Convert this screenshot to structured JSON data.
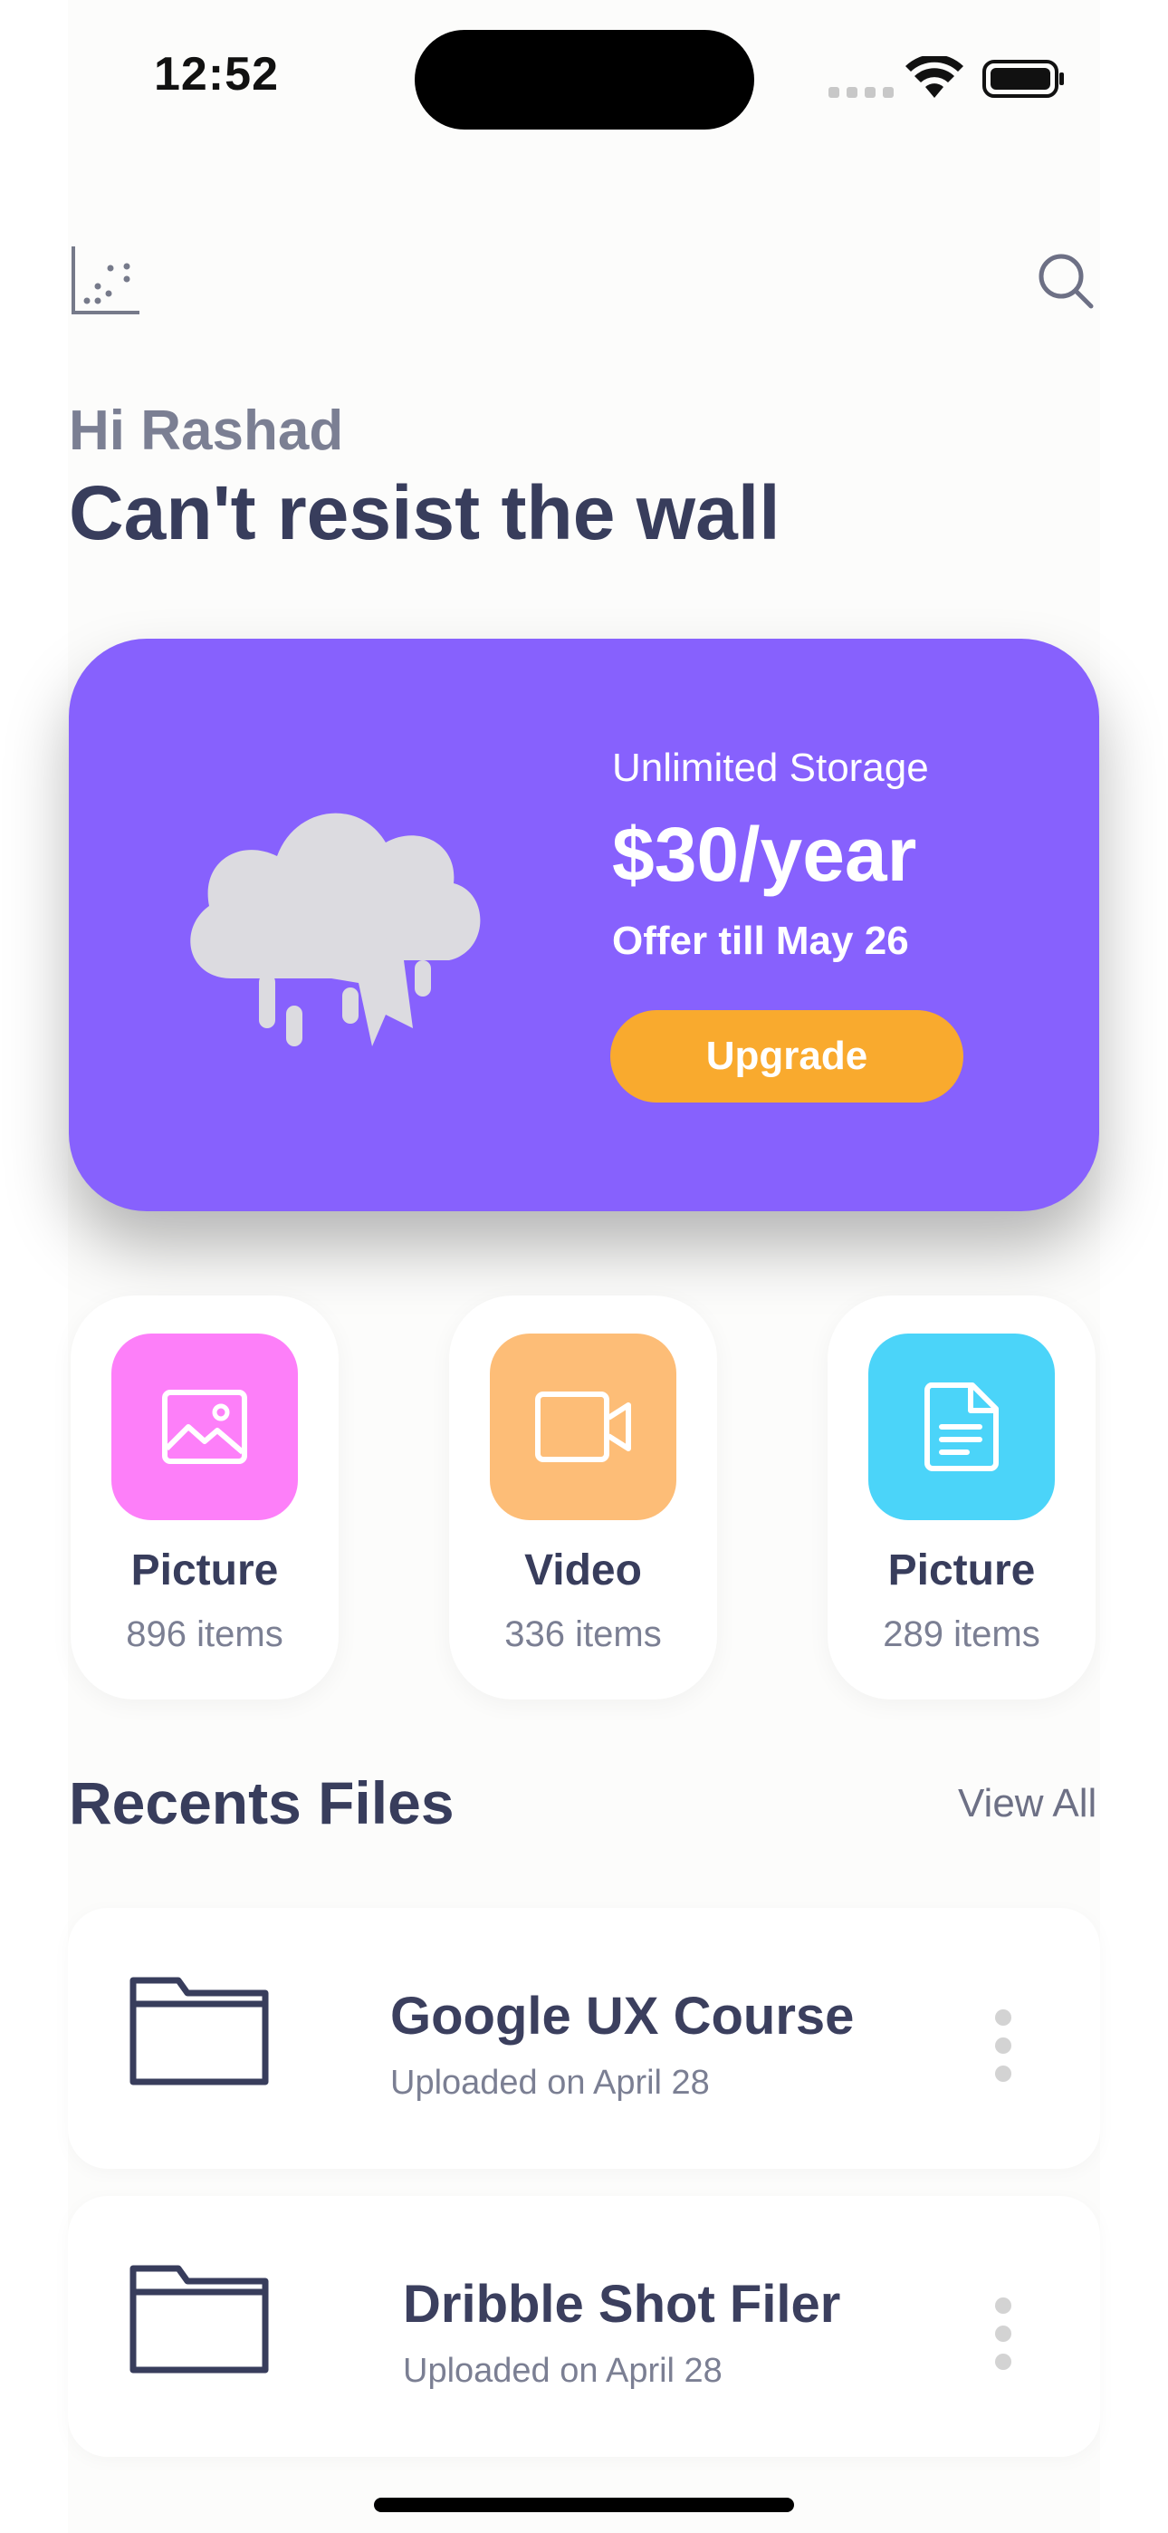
{
  "status_bar": {
    "time": "12:52"
  },
  "header": {
    "menu_icon": "scatter-chart-icon",
    "search_icon": "search-icon"
  },
  "greeting": "Hi Rashad",
  "headline": "Can't resist the wall",
  "promo": {
    "subtitle": "Unlimited Storage",
    "price": "$30/year",
    "offer": "Offer till May 26",
    "button_label": "Upgrade",
    "background_color": "#8761fd",
    "button_color": "#f9aa2e"
  },
  "categories": [
    {
      "title": "Picture",
      "count": "896 items",
      "icon": "image-icon",
      "color": "#fd7ff9"
    },
    {
      "title": "Video",
      "count": "336 items",
      "icon": "video-camera-icon",
      "color": "#fdbd77"
    },
    {
      "title": "Picture",
      "count": "289 items",
      "icon": "document-icon",
      "color": "#4bd4f9"
    }
  ],
  "recents": {
    "title": "Recents Files",
    "view_all_label": "View All",
    "files": [
      {
        "name": "Google UX Course",
        "date": "Uploaded on April 28",
        "icon": "folder-icon"
      },
      {
        "name": "Dribble Shot Filer",
        "date": "Uploaded on April 28",
        "icon": "folder-icon"
      }
    ]
  }
}
